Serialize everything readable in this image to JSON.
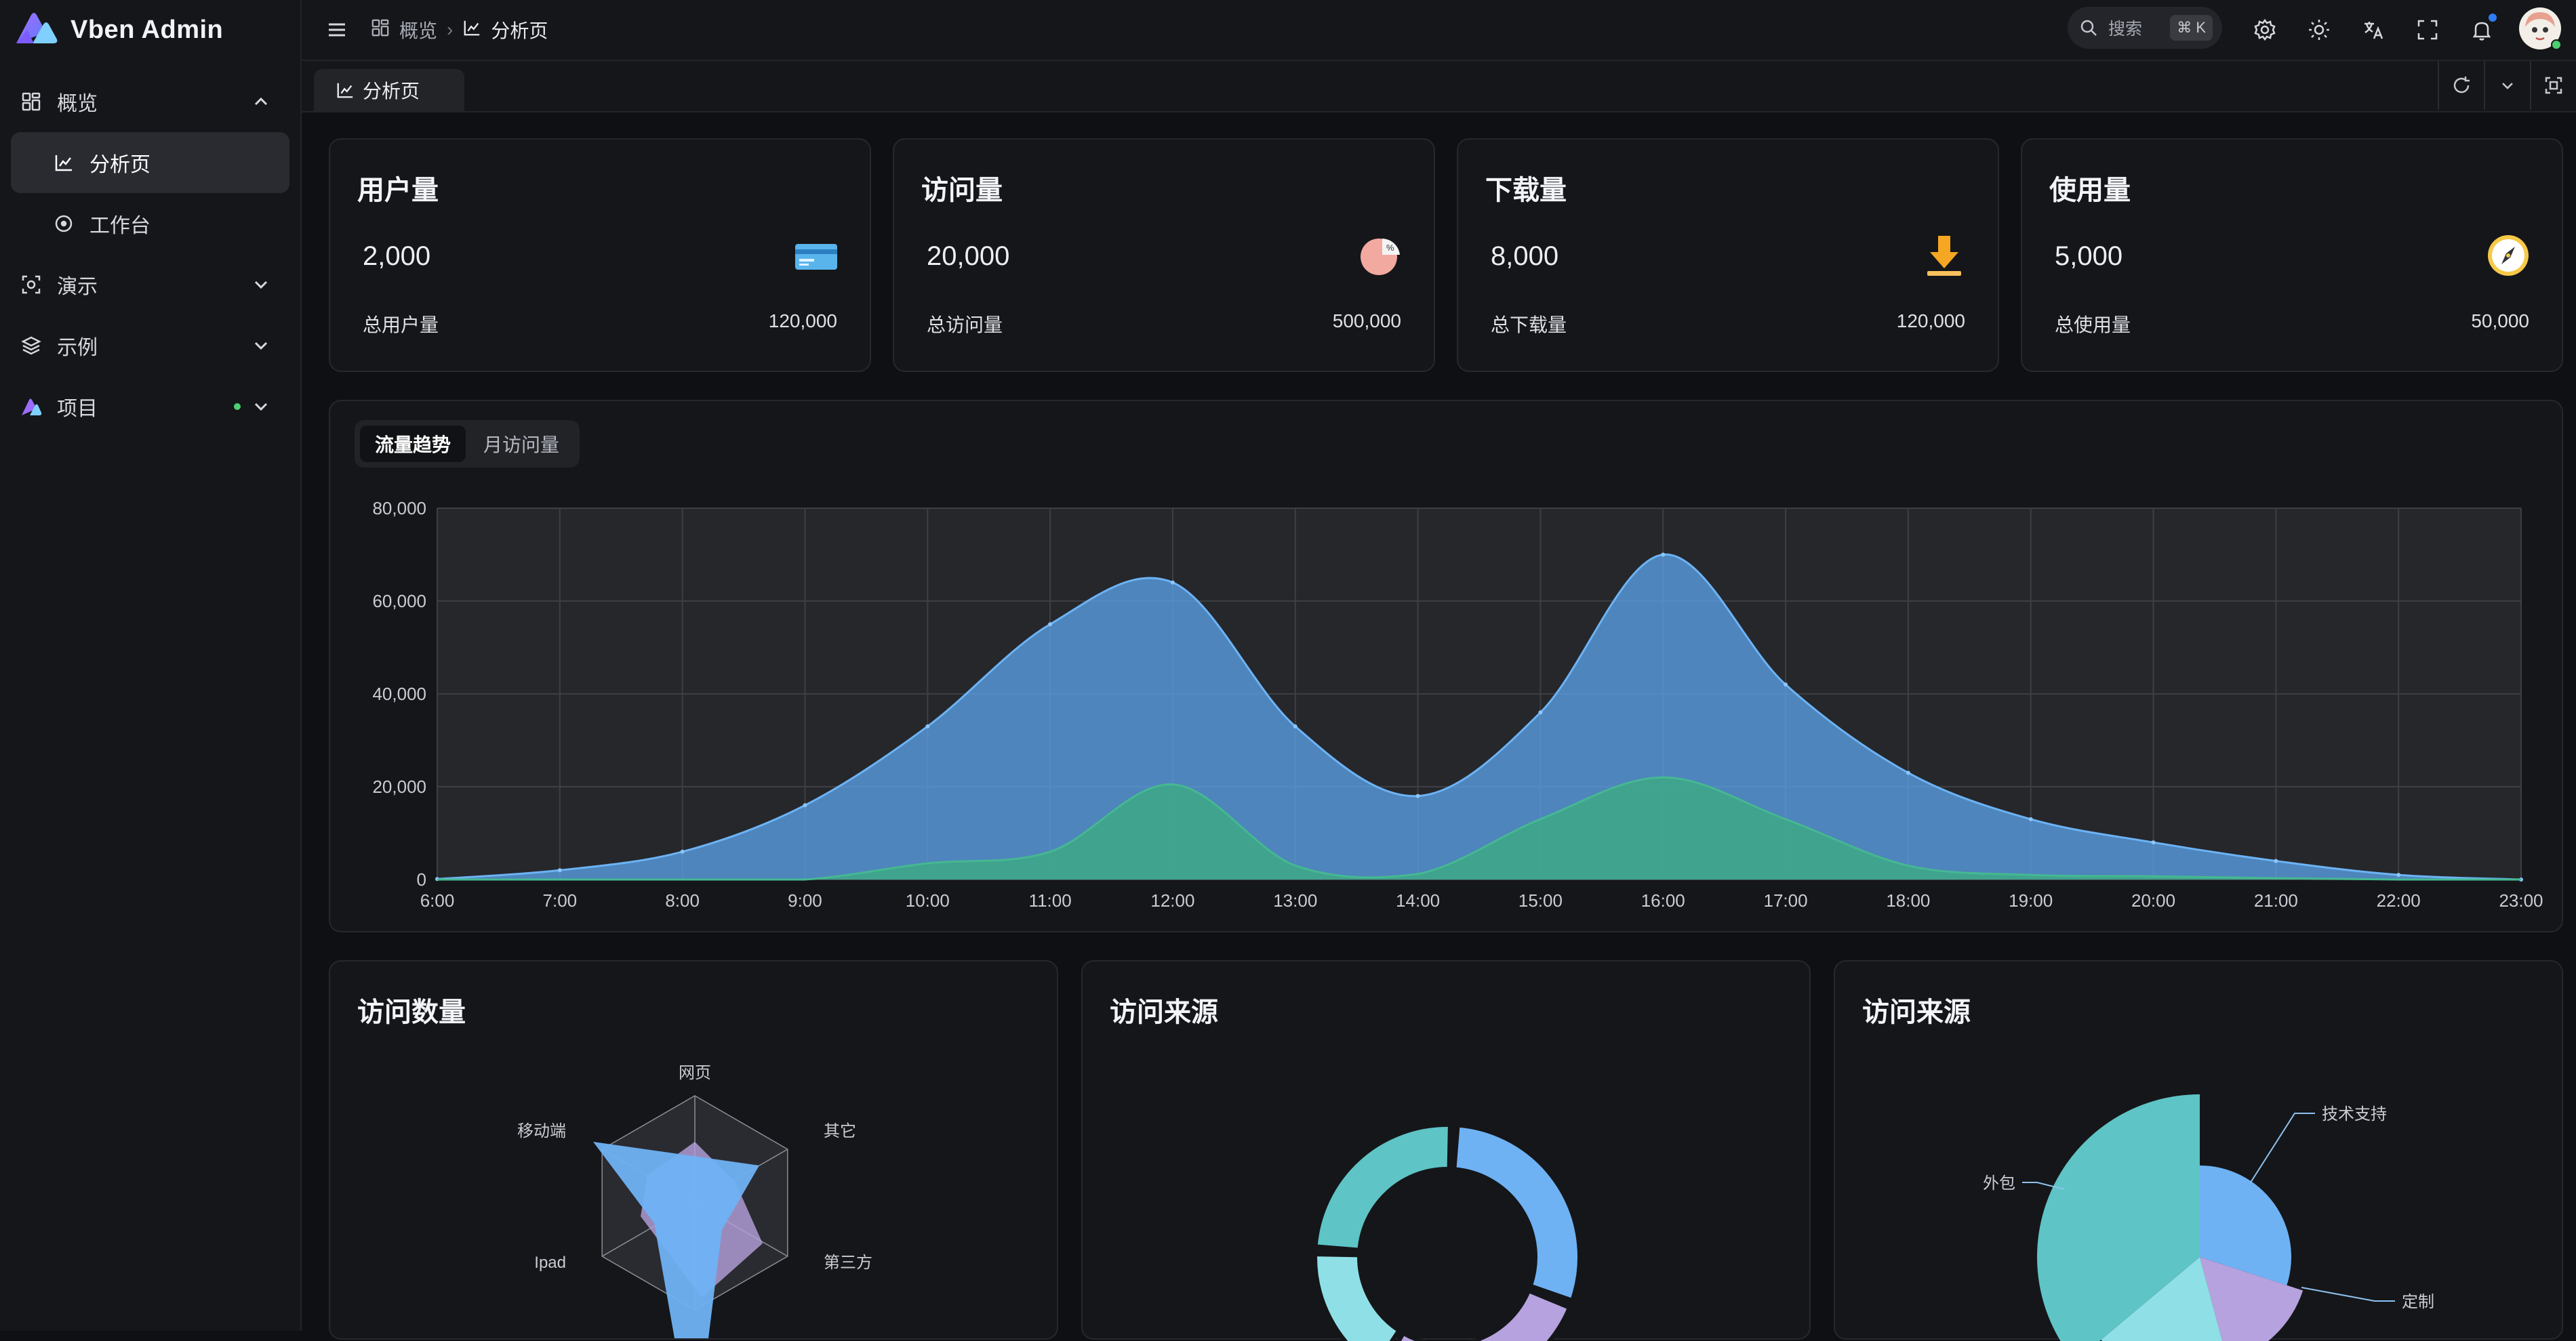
{
  "app": {
    "title": "Vben Admin"
  },
  "sidebar": {
    "items": [
      {
        "label": "概览",
        "icon": "dashboard-icon"
      },
      {
        "label": "分析页",
        "icon": "chart-icon"
      },
      {
        "label": "工作台",
        "icon": "target-icon"
      },
      {
        "label": "演示",
        "icon": "demo-icon"
      },
      {
        "label": "示例",
        "icon": "layers-icon"
      },
      {
        "label": "项目",
        "icon": "logo-icon"
      }
    ]
  },
  "header": {
    "breadcrumb": [
      "概览",
      "分析页"
    ],
    "search": {
      "placeholder": "搜索",
      "shortcut": "⌘ K"
    }
  },
  "tabs": [
    {
      "label": "分析页"
    }
  ],
  "stats": [
    {
      "title": "用户量",
      "value": "2,000",
      "sub_label": "总用户量",
      "total": "120,000",
      "icon": "credit-card-icon"
    },
    {
      "title": "访问量",
      "value": "20,000",
      "sub_label": "总访问量",
      "total": "500,000",
      "icon": "percent-pie-icon"
    },
    {
      "title": "下载量",
      "value": "8,000",
      "sub_label": "总下载量",
      "total": "120,000",
      "icon": "download-icon"
    },
    {
      "title": "使用量",
      "value": "5,000",
      "sub_label": "总使用量",
      "total": "50,000",
      "icon": "compass-icon"
    }
  ],
  "trend": {
    "tabs": [
      "流量趋势",
      "月访问量"
    ],
    "active_tab": "流量趋势"
  },
  "bottom": {
    "visits_count_title": "访问数量",
    "visit_source_title_1": "访问来源",
    "visit_source_title_2": "访问来源"
  },
  "chart_data": [
    {
      "type": "area",
      "x": [
        "6:00",
        "7:00",
        "8:00",
        "9:00",
        "10:00",
        "11:00",
        "12:00",
        "13:00",
        "14:00",
        "15:00",
        "16:00",
        "17:00",
        "18:00",
        "19:00",
        "20:00",
        "21:00",
        "22:00",
        "23:00"
      ],
      "y_ticks": [
        "0",
        "20,000",
        "40,000",
        "60,000",
        "80,000"
      ],
      "ylim": [
        0,
        80000
      ],
      "grid": true,
      "colors": [
        "#5aa0e6",
        "#3ea886"
      ],
      "series": [
        {
          "values": [
            111,
            2000,
            6000,
            16000,
            33000,
            55000,
            64000,
            33000,
            18000,
            36000,
            70000,
            42000,
            23000,
            13000,
            8000,
            4000,
            1000,
            0
          ]
        },
        {
          "values": [
            0,
            0,
            0,
            0,
            3500,
            6000,
            20500,
            3000,
            1200,
            13000,
            22000,
            13000,
            3000,
            1000,
            700,
            300,
            0,
            0
          ]
        }
      ]
    },
    {
      "type": "radar",
      "indicators": [
        "网页",
        "其它",
        "第三方",
        "Ipad",
        "移动端"
      ],
      "colors": [
        "#b6a2de",
        "#6fb2f4"
      ]
    },
    {
      "type": "donut",
      "slices": [
        {
          "color": "#6fb2f4",
          "value": 30
        },
        {
          "color": "#b6a2de",
          "value": 14
        },
        {
          "color": "#b6a2de",
          "value": 14
        },
        {
          "color": "#8fe0e6",
          "value": 17
        },
        {
          "color": "#5ec4c6",
          "value": 25
        }
      ]
    },
    {
      "type": "pie",
      "labels": [
        "技术支持",
        "定制",
        "外包"
      ],
      "colors": [
        "#6fb2f4",
        "#b6a2de",
        "#8fe0e6",
        "#5ec4c6"
      ]
    }
  ]
}
